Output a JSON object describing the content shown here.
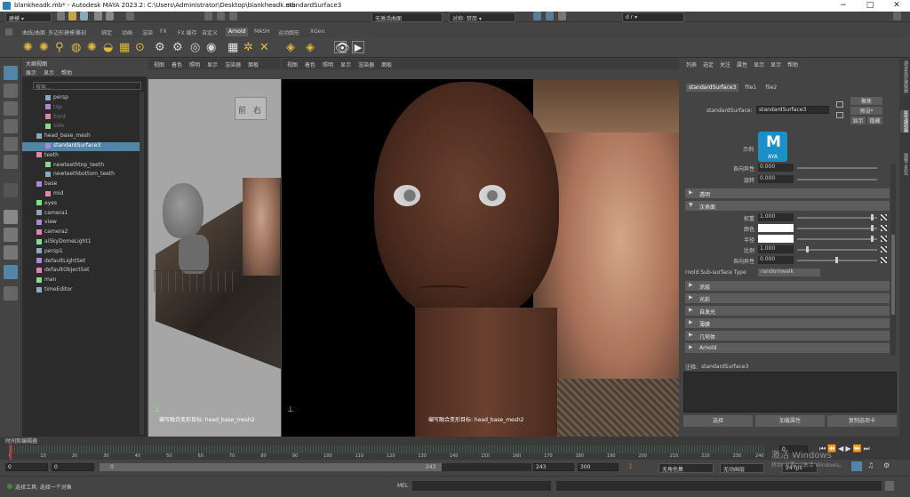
{
  "title_bar": {
    "app_title": "blankheadk.mb* - Autodesk MAYA 2023.2: C:\\Users\\Administrator\\Desktop\\blankheadk.mb",
    "separator": "---",
    "selection": "standardSurface3"
  },
  "status_line": {
    "menu_set": "建模",
    "no_live_surface": "无激活曲面",
    "symmetry": "对称: 禁用",
    "user": "d r"
  },
  "shelf_tabs": [
    "曲线/曲面",
    "多边形建模",
    "雕刻",
    "绑定",
    "动画",
    "渲染",
    "FX",
    "FX 缓存",
    "自定义",
    "Arnold",
    "MASH",
    "运动图形",
    "XGen"
  ],
  "shelf_active_tab": "Arnold",
  "outliner": {
    "menu": [
      "展示",
      "显示",
      "帮助"
    ],
    "title": "大纲视图",
    "search_placeholder": "搜索...",
    "items": [
      {
        "label": "persp",
        "indent": 2,
        "dim": false
      },
      {
        "label": "top",
        "indent": 2,
        "dim": true
      },
      {
        "label": "front",
        "indent": 2,
        "dim": true
      },
      {
        "label": "side",
        "indent": 2,
        "dim": true
      },
      {
        "label": "head_base_mesh",
        "indent": 1,
        "dim": false
      },
      {
        "label": "standardSurface3",
        "indent": 2,
        "dim": false,
        "selected": true
      },
      {
        "label": "teeth",
        "indent": 1,
        "dim": false
      },
      {
        "label": "newteethtop_teeth",
        "indent": 2,
        "dim": false
      },
      {
        "label": "newteethbottom_teeth",
        "indent": 2,
        "dim": false
      },
      {
        "label": "base",
        "indent": 1,
        "dim": false
      },
      {
        "label": "mid",
        "indent": 2,
        "dim": false
      },
      {
        "label": "eyes",
        "indent": 1,
        "dim": false
      },
      {
        "label": "camera1",
        "indent": 1,
        "dim": false
      },
      {
        "label": "view",
        "indent": 1,
        "dim": false
      },
      {
        "label": "camera2",
        "indent": 1,
        "dim": false
      },
      {
        "label": "aiSkyDomeLight1",
        "indent": 1,
        "dim": false
      },
      {
        "label": "persp1",
        "indent": 1,
        "dim": false
      },
      {
        "label": "defaultLightSet",
        "indent": 1,
        "dim": false
      },
      {
        "label": "defaultObjectSet",
        "indent": 1,
        "dim": false
      },
      {
        "label": "man",
        "indent": 1,
        "dim": false
      },
      {
        "label": "timeEditor",
        "indent": 1,
        "dim": false
      }
    ]
  },
  "viewport_menu": [
    "视图",
    "着色",
    "照明",
    "显示",
    "渲染器",
    "面板"
  ],
  "viewport_left": {
    "cube_front": "前",
    "cube_right": "右",
    "hud": "编写融合变形目标: head_base_mesh2"
  },
  "viewport_main": {
    "hud": "编写融合变形目标: head_base_mesh2"
  },
  "attribute_editor": {
    "menu": [
      "列表",
      "选定",
      "关注",
      "属性",
      "显示",
      "显示",
      "帮助"
    ],
    "tabs": [
      "standardSurface3",
      "file1",
      "file2"
    ],
    "label": "standardSurface:",
    "name_value": "standardSurface3",
    "focus_btn": "聚焦",
    "presets_btn": "预设*",
    "show_btn": "显示",
    "hide_btn": "隐藏",
    "sample_label": "示例",
    "logo_text": "AYA",
    "rows_top": [
      {
        "label": "各向异性",
        "value": "0.000"
      },
      {
        "label": "旋转",
        "value": "0.000"
      }
    ],
    "sections": [
      {
        "label": "透明",
        "open": false
      },
      {
        "label": "次表面",
        "open": true
      }
    ],
    "subsurface_rows": [
      {
        "label": "权重",
        "value": "1.000",
        "pos": 0.97
      },
      {
        "label": "颜色",
        "value": "",
        "pos": 0.97,
        "swatch": "#ffffff"
      },
      {
        "label": "半径",
        "value": "",
        "pos": 0.97,
        "swatch": "#ffffff"
      },
      {
        "label": "比例",
        "value": "1.000",
        "pos": 0.12
      },
      {
        "label": "各向异性",
        "value": "0.000",
        "pos": 0.5
      }
    ],
    "subsurface_type_label": "rnold Sub-surface Type",
    "subsurface_type_value": "randomwalk",
    "sections_bottom": [
      "涂层",
      "光彩",
      "自发光",
      "薄膜",
      "几何体",
      "Arnold"
    ],
    "notes_label": "注释:",
    "notes_target": "standardSurface3",
    "bottom_buttons": [
      "选择",
      "加载属性",
      "复制选项卡"
    ]
  },
  "side_tabs": [
    "通道盒/层编辑器",
    "属性编辑器",
    "建模工具包"
  ],
  "time_slider": {
    "title": "时间剪编辑器",
    "ticks": [
      "0",
      "10",
      "20",
      "30",
      "40",
      "50",
      "60",
      "70",
      "80",
      "90",
      "100",
      "110",
      "120",
      "130",
      "140",
      "150",
      "160",
      "170",
      "180",
      "190",
      "200",
      "210",
      "220",
      "230",
      "240"
    ],
    "current_frame": "0"
  },
  "range_slider": {
    "start": "0",
    "inner_start": "0",
    "range_start": "0",
    "range_end": "243",
    "inner_end": "243",
    "end": "300",
    "character_set": "无角色集",
    "anim_layer": "无动画层",
    "fps": "24 fps"
  },
  "command_line": {
    "help": "选择工具: 选择一个对象",
    "mel": "MEL"
  },
  "watermark": {
    "line1": "激活 Windows",
    "line2": "转到\"设置\"以激活 Windows。"
  },
  "colors": {
    "selection": "#5285a6",
    "shelf_bg": "#464646",
    "panel_bg": "#2b2b2b",
    "viewport_gray": "#a0a0a0"
  }
}
